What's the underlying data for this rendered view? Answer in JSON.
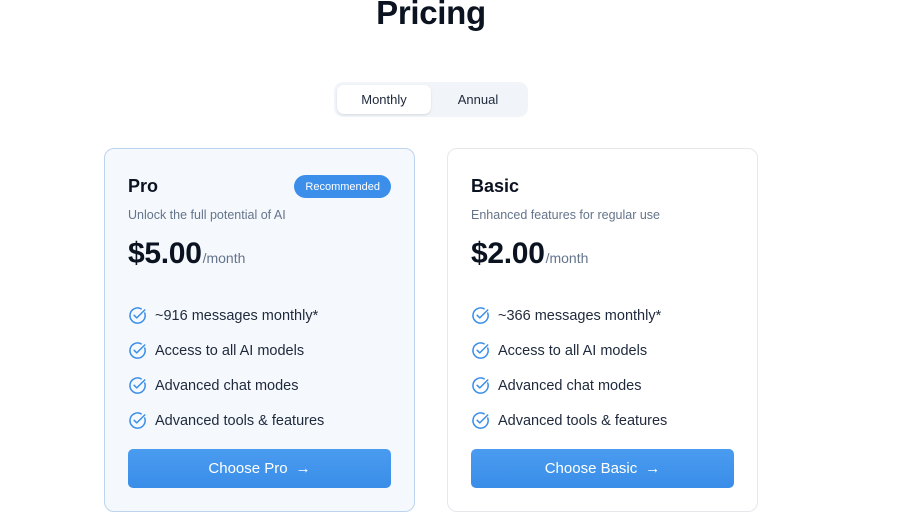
{
  "page": {
    "title": "Pricing"
  },
  "billing_toggle": {
    "options": [
      "Monthly",
      "Annual"
    ],
    "selected": "Monthly"
  },
  "plans": [
    {
      "name": "Pro",
      "badge": "Recommended",
      "description": "Unlock the full potential of AI",
      "price": "$5.00",
      "period": "/month",
      "features": [
        "~916 messages monthly*",
        "Access to all AI models",
        "Advanced chat modes",
        "Advanced tools & features"
      ],
      "cta_label": "Choose Pro",
      "cta_arrow": "→",
      "feature_icon": "check-circle-icon"
    },
    {
      "name": "Basic",
      "description": "Enhanced features for regular use",
      "price": "$2.00",
      "period": "/month",
      "features": [
        "~366 messages monthly*",
        "Access to all AI models",
        "Advanced chat modes",
        "Advanced tools & features"
      ],
      "cta_label": "Choose Basic",
      "cta_arrow": "→",
      "feature_icon": "check-circle-icon"
    }
  ],
  "colors": {
    "accent": "#3b8eea",
    "recommended_card_bg": "#f5f9fd",
    "recommended_card_border": "#bcd4ee"
  }
}
